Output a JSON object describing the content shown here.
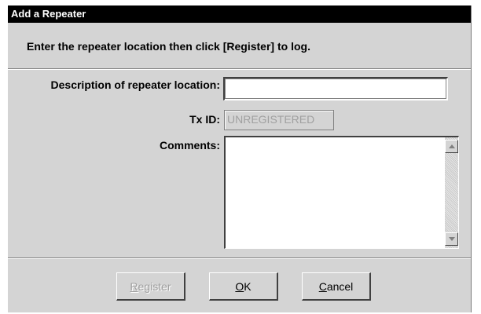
{
  "window": {
    "title": "Add a Repeater"
  },
  "instruction": "Enter the repeater location then click [Register] to log.",
  "form": {
    "description_label": "Description of repeater location:",
    "description_value": "",
    "txid_label": "Tx ID:",
    "txid_value": "UNREGISTERED",
    "comments_label": "Comments:",
    "comments_value": ""
  },
  "buttons": {
    "register": {
      "mnemonic": "R",
      "rest": "egister"
    },
    "ok": {
      "mnemonic": "O",
      "rest": "K"
    },
    "cancel": {
      "mnemonic": "C",
      "rest": "ancel"
    }
  },
  "icons": {
    "scroll_up": "scroll-up-arrow-icon",
    "scroll_down": "scroll-down-arrow-icon"
  },
  "colors": {
    "titlebar_bg": "#000000",
    "dialog_bg": "#d4d4d4",
    "disabled_text": "#a0a0a0"
  }
}
